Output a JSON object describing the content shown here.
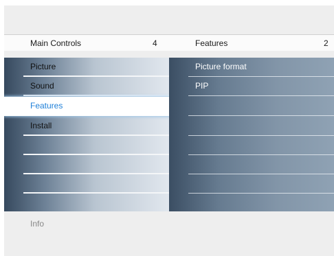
{
  "header": {
    "left_title": "Main Controls",
    "left_count": "4",
    "right_title": "Features",
    "right_count": "2"
  },
  "menu": {
    "items": [
      {
        "label": "Picture"
      },
      {
        "label": "Sound"
      },
      {
        "label": "Features",
        "selected": true
      },
      {
        "label": "Install"
      }
    ]
  },
  "submenu": {
    "items": [
      {
        "label": "Picture format"
      },
      {
        "label": "PIP"
      }
    ]
  },
  "footer": {
    "info_label": "Info"
  },
  "colors": {
    "selected_text": "#1e7fd8",
    "selection_glow": "#9ec7e8"
  }
}
